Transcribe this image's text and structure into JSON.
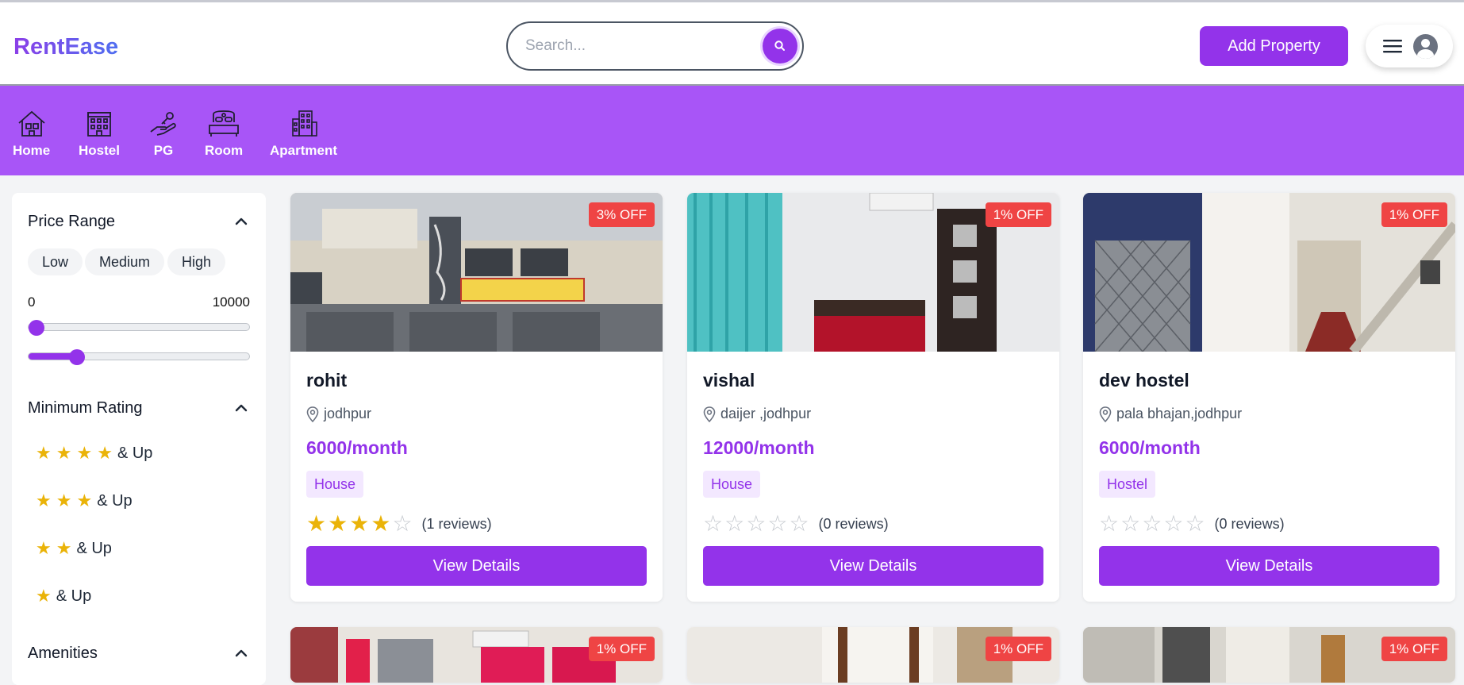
{
  "header": {
    "brand": "RentEase",
    "search_placeholder": "Search...",
    "add_property_label": "Add Property"
  },
  "categories": [
    {
      "label": "Home",
      "icon": "house-icon"
    },
    {
      "label": "Hostel",
      "icon": "hostel-building-icon"
    },
    {
      "label": "PG",
      "icon": "hand-key-icon"
    },
    {
      "label": "Room",
      "icon": "bed-icon"
    },
    {
      "label": "Apartment",
      "icon": "apartment-icon"
    }
  ],
  "sidebar": {
    "price_range": {
      "title": "Price Range",
      "chips": [
        "Low",
        "Medium",
        "High"
      ],
      "min_label": "0",
      "max_label": "10000",
      "min_value_fraction": 0.0,
      "max_value_fraction": 0.22
    },
    "min_rating": {
      "title": "Minimum Rating",
      "suffix": "& Up",
      "options": [
        4,
        3,
        2,
        1
      ]
    },
    "amenities": {
      "title": "Amenities"
    }
  },
  "listings": [
    {
      "name": "rohit",
      "location": "jodhpur",
      "price": "6000/month",
      "type": "House",
      "rating": 4,
      "reviews": "(1 reviews)",
      "discount": "3% OFF",
      "button": "View Details"
    },
    {
      "name": "vishal",
      "location": "daijer ,jodhpur",
      "price": "12000/month",
      "type": "House",
      "rating": 0,
      "reviews": "(0 reviews)",
      "discount": "1% OFF",
      "button": "View Details"
    },
    {
      "name": "dev hostel",
      "location": "pala bhajan,jodhpur",
      "price": "6000/month",
      "type": "Hostel",
      "rating": 0,
      "reviews": "(0 reviews)",
      "discount": "1% OFF",
      "button": "View Details"
    },
    {
      "discount": "1% OFF"
    },
    {
      "discount": "1% OFF"
    },
    {
      "discount": "1% OFF"
    }
  ],
  "colors": {
    "accent": "#9333ea",
    "category_bar": "#a855f7",
    "badge": "#ef4444",
    "star": "#eab308"
  }
}
